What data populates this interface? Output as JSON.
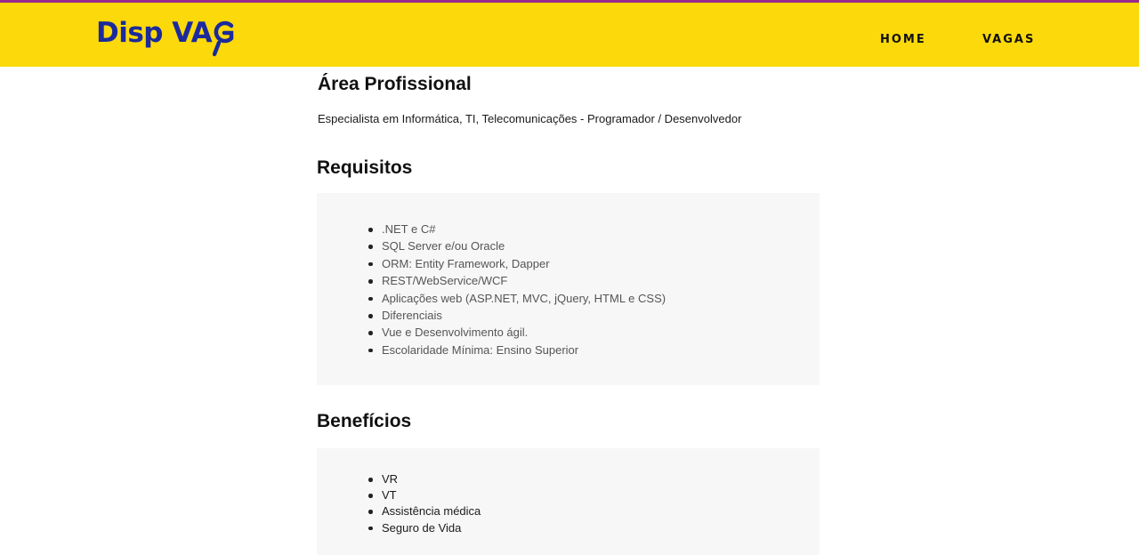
{
  "brand": {
    "name": "Disp VA",
    "accent": "#1b2a9c",
    "header_bg": "#fcd90b"
  },
  "nav": {
    "home": "HOME",
    "vagas": "VAGAS"
  },
  "area": {
    "title": "Área Profissional",
    "text": "Especialista em Informática, TI, Telecomunicações - Programador / Desenvolvedor"
  },
  "requisitos": {
    "title": "Requisitos",
    "items": [
      ".NET e C#",
      "SQL Server e/ou Oracle",
      "ORM: Entity Framework, Dapper",
      "REST/WebService/WCF",
      "Aplicações web (ASP.NET, MVC, jQuery, HTML e CSS)",
      "Diferenciais",
      "Vue e Desenvolvimento ágil.",
      "Escolaridade Mínima: Ensino Superior"
    ]
  },
  "beneficios": {
    "title": "Benefícios",
    "items": [
      "VR",
      "VT",
      "Assistência médica",
      "Seguro de Vida"
    ]
  }
}
